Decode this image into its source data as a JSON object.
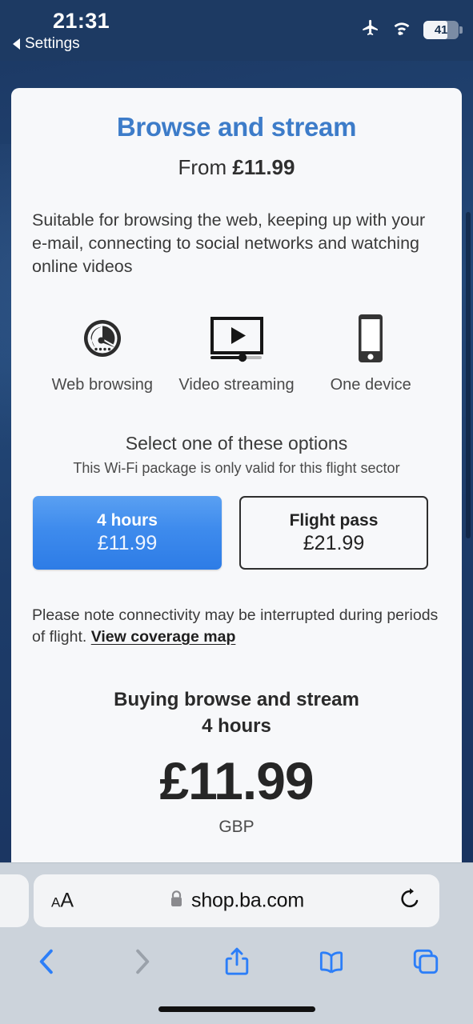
{
  "statusbar": {
    "time": "21:31",
    "back_label": "Settings",
    "airplane_icon": "airplane-icon",
    "wifi_icon": "wifi-icon",
    "battery_level": "41"
  },
  "page": {
    "title": "Browse and stream",
    "subtitle_prefix": "From ",
    "subtitle_price": "£11.99",
    "description": "Suitable for browsing the web, keeping up with your e-mail, connecting to social networks and watching online videos",
    "features": [
      {
        "icon": "speedometer-icon",
        "label": "Web browsing"
      },
      {
        "icon": "video-player-icon",
        "label": "Video streaming"
      },
      {
        "icon": "smartphone-icon",
        "label": "One device"
      }
    ],
    "select_heading": "Select one of these options",
    "select_subheading": "This Wi-Fi package is only valid for this flight sector",
    "options": [
      {
        "name": "4 hours",
        "price": "£11.99",
        "selected": true
      },
      {
        "name": "Flight pass",
        "price": "£21.99",
        "selected": false
      }
    ],
    "note_text": "Please note connectivity may be interrupted during periods of flight. ",
    "note_link": "View coverage map",
    "summary_line1": "Buying browse and stream",
    "summary_line2": "4 hours",
    "summary_price": "£11.99",
    "summary_currency": "GBP",
    "colors": {
      "accent_blue": "#3d7cc9",
      "selected_button": "#3e8bed",
      "page_background": "#1d3a63",
      "card_background": "#f7f8fa"
    }
  },
  "browser": {
    "text_size_small": "A",
    "text_size_large": "A",
    "lock_icon": "lock-icon",
    "url": "shop.ba.com",
    "reload_icon": "reload-icon",
    "back_icon": "chevron-left-icon",
    "forward_icon": "chevron-right-icon",
    "share_icon": "share-icon",
    "bookmarks_icon": "book-icon",
    "tabs_icon": "tabs-icon"
  }
}
